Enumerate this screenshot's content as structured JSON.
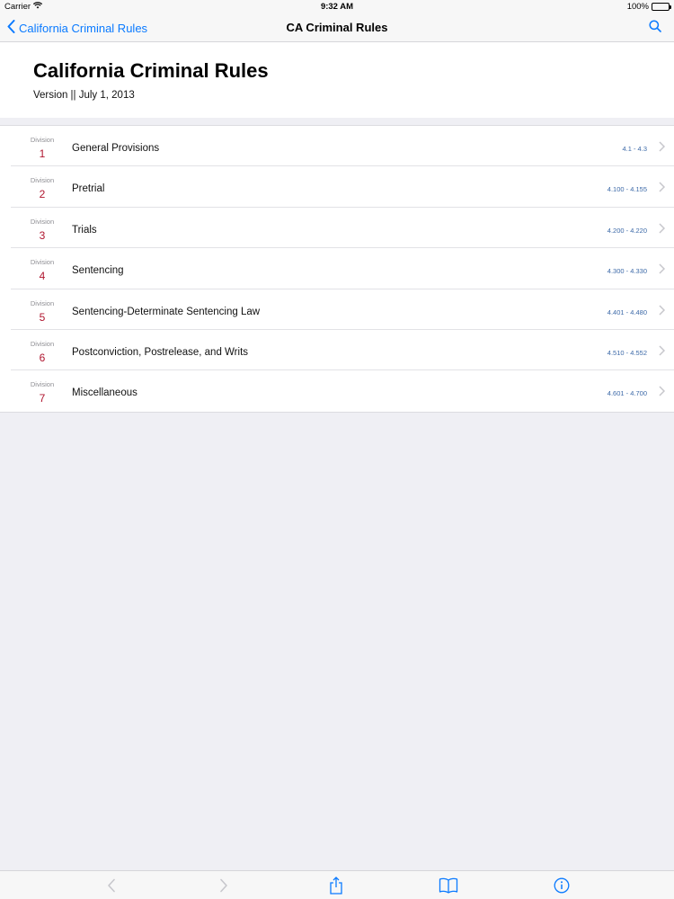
{
  "status_bar": {
    "carrier": "Carrier",
    "time": "9:32 AM",
    "battery": "100%"
  },
  "nav": {
    "back_label": "California Criminal Rules",
    "title": "CA Criminal Rules",
    "accent_color": "#0a7aff",
    "search_icon": "search-icon"
  },
  "header": {
    "title": "California Criminal Rules",
    "version": "Version || July 1, 2013"
  },
  "divisions": [
    {
      "label": "Division",
      "number": "1",
      "title": "General Provisions",
      "range": "4.1 - 4.3"
    },
    {
      "label": "Division",
      "number": "2",
      "title": "Pretrial",
      "range": "4.100 - 4.155"
    },
    {
      "label": "Division",
      "number": "3",
      "title": "Trials",
      "range": "4.200 - 4.220"
    },
    {
      "label": "Division",
      "number": "4",
      "title": "Sentencing",
      "range": "4.300 - 4.330"
    },
    {
      "label": "Division",
      "number": "5",
      "title": "Sentencing-Determinate Sentencing Law",
      "range": "4.401 - 4.480"
    },
    {
      "label": "Division",
      "number": "6",
      "title": "Postconviction, Postrelease, and Writs",
      "range": "4.510 - 4.552"
    },
    {
      "label": "Division",
      "number": "7",
      "title": "Miscellaneous",
      "range": "4.601 - 4.700"
    }
  ],
  "toolbar": {
    "icons": [
      "back-arrow-icon",
      "forward-arrow-icon",
      "share-icon",
      "bookmarks-icon",
      "info-icon"
    ]
  }
}
